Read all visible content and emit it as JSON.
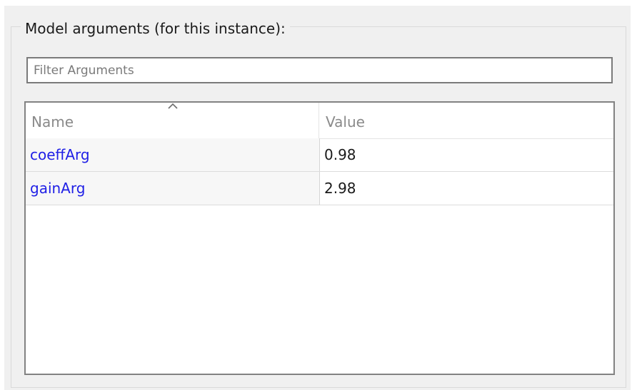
{
  "group": {
    "title": "Model arguments (for this instance):"
  },
  "filter": {
    "placeholder": "Filter Arguments",
    "value": ""
  },
  "table": {
    "columns": [
      "Name",
      "Value"
    ],
    "sort_icon": "chevron-up-icon",
    "rows": [
      {
        "name": "coeffArg",
        "value": "0.98"
      },
      {
        "name": "gainArg",
        "value": "2.98"
      }
    ]
  },
  "colors": {
    "panel_background": "#f0f0f0",
    "argument_name": "#1f1fe6",
    "header_text": "#8a8a8a"
  }
}
